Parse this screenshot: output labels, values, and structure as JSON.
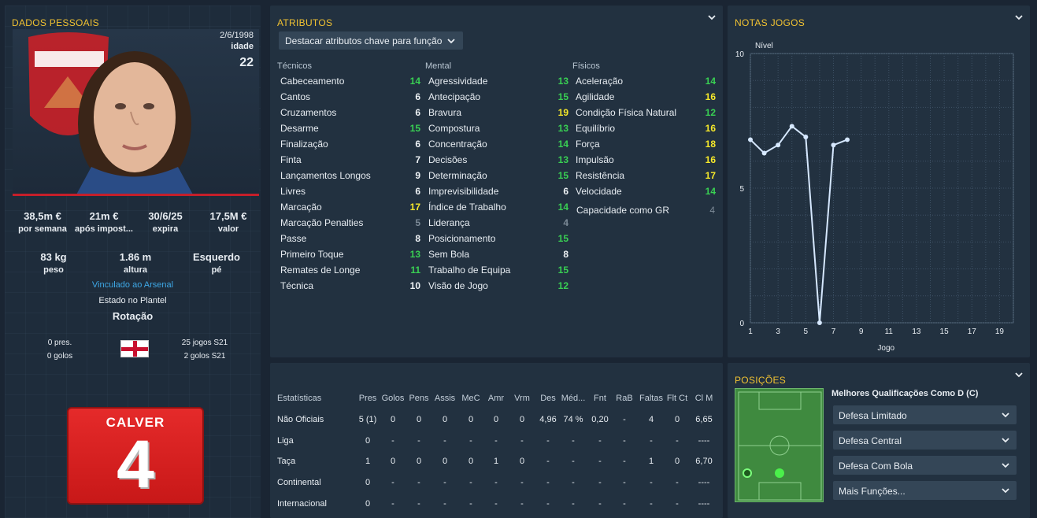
{
  "personal": {
    "title": "DADOS PESSOAIS",
    "dob": "2/6/1998",
    "age_label": "idade",
    "age": "22",
    "money": [
      {
        "v": "38,5m €",
        "l": "por semana"
      },
      {
        "v": "21m €",
        "l": "após impost..."
      },
      {
        "v": "30/6/25",
        "l": "expira"
      },
      {
        "v": "17,5M €",
        "l": "valor"
      }
    ],
    "body": [
      {
        "v": "83 kg",
        "l": "peso"
      },
      {
        "v": "1.86 m",
        "l": "altura"
      },
      {
        "v": "Esquerdo",
        "l": "pé"
      }
    ],
    "club_link": "Vinculado ao Arsenal",
    "squad_status_label": "Estado no Plantel",
    "squad_status": "Rotação",
    "intl_caps": "0 pres.",
    "intl_goals": "0 golos",
    "club_games": "25 jogos S21",
    "club_goals": "2 golos S21",
    "shirt_name": "CALVER",
    "shirt_number": "4",
    "colors": {
      "kit": "#e52a2a",
      "accent": "#f1c232",
      "link": "#3ea8e6"
    }
  },
  "attributes": {
    "title": "ATRIBUTOS",
    "highlight_dropdown": "Destacar atributos chave para função",
    "columns": [
      "Técnicos",
      "Mental",
      "Físicos"
    ],
    "technical": [
      {
        "name": "Cabeceamento",
        "value": "14",
        "tier": "gr"
      },
      {
        "name": "Cantos",
        "value": "6",
        "tier": "w"
      },
      {
        "name": "Cruzamentos",
        "value": "6",
        "tier": "w"
      },
      {
        "name": "Desarme",
        "value": "15",
        "tier": "gr"
      },
      {
        "name": "Finalização",
        "value": "6",
        "tier": "w"
      },
      {
        "name": "Finta",
        "value": "7",
        "tier": "w"
      },
      {
        "name": "Lançamentos Longos",
        "value": "9",
        "tier": "w"
      },
      {
        "name": "Livres",
        "value": "6",
        "tier": "w"
      },
      {
        "name": "Marcação",
        "value": "17",
        "tier": "y"
      },
      {
        "name": "Marcação Penalties",
        "value": "5",
        "tier": "g"
      },
      {
        "name": "Passe",
        "value": "8",
        "tier": "w"
      },
      {
        "name": "Primeiro Toque",
        "value": "13",
        "tier": "gr"
      },
      {
        "name": "Remates de Longe",
        "value": "11",
        "tier": "gr"
      },
      {
        "name": "Técnica",
        "value": "10",
        "tier": "w"
      }
    ],
    "mental": [
      {
        "name": "Agressividade",
        "value": "13",
        "tier": "gr"
      },
      {
        "name": "Antecipação",
        "value": "15",
        "tier": "gr"
      },
      {
        "name": "Bravura",
        "value": "19",
        "tier": "y"
      },
      {
        "name": "Compostura",
        "value": "13",
        "tier": "gr"
      },
      {
        "name": "Concentração",
        "value": "14",
        "tier": "gr"
      },
      {
        "name": "Decisões",
        "value": "13",
        "tier": "gr"
      },
      {
        "name": "Determinação",
        "value": "15",
        "tier": "gr"
      },
      {
        "name": "Imprevisibilidade",
        "value": "6",
        "tier": "w"
      },
      {
        "name": "Índice de Trabalho",
        "value": "14",
        "tier": "gr"
      },
      {
        "name": "Liderança",
        "value": "4",
        "tier": "g"
      },
      {
        "name": "Posicionamento",
        "value": "15",
        "tier": "gr"
      },
      {
        "name": "Sem Bola",
        "value": "8",
        "tier": "w"
      },
      {
        "name": "Trabalho de Equipa",
        "value": "15",
        "tier": "gr"
      },
      {
        "name": "Visão de Jogo",
        "value": "12",
        "tier": "gr"
      }
    ],
    "physical": [
      {
        "name": "Aceleração",
        "value": "14",
        "tier": "gr"
      },
      {
        "name": "Agilidade",
        "value": "16",
        "tier": "y"
      },
      {
        "name": "Condição Física Natural",
        "value": "12",
        "tier": "gr"
      },
      {
        "name": "Equilíbrio",
        "value": "16",
        "tier": "y"
      },
      {
        "name": "Força",
        "value": "18",
        "tier": "y"
      },
      {
        "name": "Impulsão",
        "value": "16",
        "tier": "y"
      },
      {
        "name": "Resistência",
        "value": "17",
        "tier": "y"
      },
      {
        "name": "Velocidade",
        "value": "14",
        "tier": "gr"
      }
    ],
    "gk": {
      "name": "Capacidade como GR",
      "value": "4"
    }
  },
  "ratings": {
    "title": "NOTAS JOGOS",
    "chart_data": {
      "type": "line",
      "ylabel": "Nível",
      "xlabel": "Jogo",
      "ylim": [
        0,
        10
      ],
      "yticks": [
        "0",
        "5",
        "10"
      ],
      "xlim": [
        1,
        20
      ],
      "xticks": [
        "1",
        "3",
        "5",
        "7",
        "9",
        "11",
        "13",
        "15",
        "17",
        "19"
      ],
      "x": [
        1,
        2,
        3,
        4,
        5,
        6,
        7,
        8
      ],
      "values": [
        6.8,
        6.3,
        6.6,
        7.3,
        6.9,
        0,
        6.6,
        6.8
      ],
      "grid": true,
      "color": "#d6e8ff"
    }
  },
  "stats": {
    "headers": [
      "Estatísticas",
      "Pres",
      "Golos",
      "Pens",
      "Assis",
      "MeC",
      "Amr",
      "Vrm",
      "Des",
      "Méd...",
      "Fnt",
      "RaB",
      "Faltas",
      "Flt Ct",
      "Cl M"
    ],
    "rows": [
      {
        "label": "Não Oficiais",
        "cells": [
          "5 (1)",
          "0",
          "0",
          "0",
          "0",
          "0",
          "0",
          "4,96",
          "74 %",
          "0,20",
          "-",
          "4",
          "0",
          "6,65"
        ]
      },
      {
        "label": "Liga",
        "cells": [
          "0",
          "-",
          "-",
          "-",
          "-",
          "-",
          "-",
          "-",
          "-",
          "-",
          "-",
          "-",
          "-",
          "----"
        ]
      },
      {
        "label": "Taça",
        "cells": [
          "1",
          "0",
          "0",
          "0",
          "0",
          "1",
          "0",
          "-",
          "-",
          "-",
          "-",
          "1",
          "0",
          "6,70"
        ]
      },
      {
        "label": "Continental",
        "cells": [
          "0",
          "-",
          "-",
          "-",
          "-",
          "-",
          "-",
          "-",
          "-",
          "-",
          "-",
          "-",
          "-",
          "----"
        ]
      },
      {
        "label": "Internacional",
        "cells": [
          "0",
          "-",
          "-",
          "-",
          "-",
          "-",
          "-",
          "-",
          "-",
          "-",
          "-",
          "-",
          "-",
          "----"
        ]
      }
    ]
  },
  "positions": {
    "title": "POSIÇÕES",
    "best_label": "Melhores Qualificações Como D (C)",
    "roles": [
      "Defesa Limitado",
      "Defesa Central",
      "Defesa Com Bola",
      "Mais Funções..."
    ]
  }
}
